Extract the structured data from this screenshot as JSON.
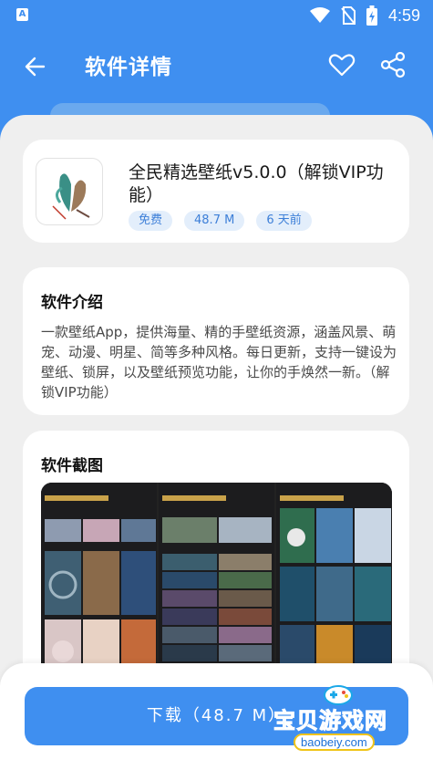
{
  "status_bar": {
    "app_icon": "A",
    "time": "4:59",
    "icons": [
      "wifi-icon",
      "no-sim-icon",
      "battery-charging-icon"
    ]
  },
  "header": {
    "title": "软件详情",
    "back_icon": "arrow-left-icon",
    "favorite_icon": "heart-outline-icon",
    "share_icon": "share-icon"
  },
  "app": {
    "name": "全民精选壁纸v5.0.0（解锁VIP功能）",
    "tags": [
      "免费",
      "48.7 M",
      "6 天前"
    ]
  },
  "intro": {
    "title": "软件介绍",
    "text": "一款壁纸App，提供海量、精的手壁纸资源，涵盖风景、萌宠、动漫、明星、简等多种风格。每日更新，支持一键设为壁纸、锁屏，以及壁纸预览功能，让你的手焕然一新。（解锁VIP功能）"
  },
  "screenshots": {
    "title": "软件截图"
  },
  "download": {
    "label": "下载（48.7 M）"
  },
  "watermark": {
    "text": "宝贝游戏网",
    "url": "baobeiy.com"
  },
  "colors": {
    "primary": "#3f8ff0",
    "sheet_bg": "#efefef",
    "tag_bg": "#e3eefb",
    "tag_text": "#3d7fd8"
  }
}
